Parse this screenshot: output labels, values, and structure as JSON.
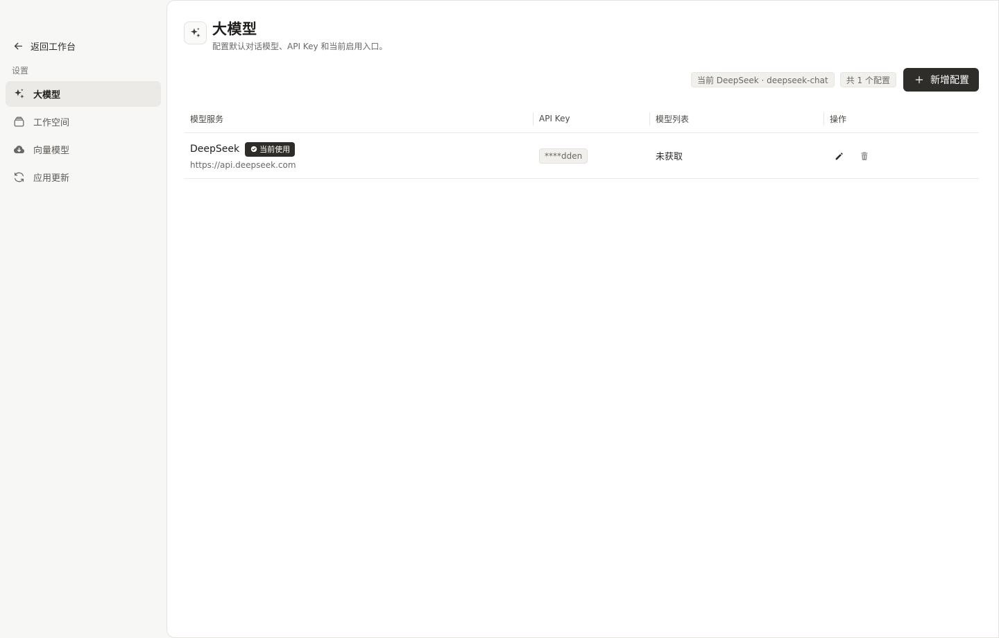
{
  "sidebar": {
    "back_label": "返回工作台",
    "section_label": "设置",
    "items": [
      {
        "label": "大模型",
        "icon": "sparkles-icon",
        "active": true
      },
      {
        "label": "工作空间",
        "icon": "archive-icon",
        "active": false
      },
      {
        "label": "向量模型",
        "icon": "cloud-download-icon",
        "active": false
      },
      {
        "label": "应用更新",
        "icon": "refresh-icon",
        "active": false
      }
    ]
  },
  "header": {
    "title": "大模型",
    "subtitle": "配置默认对话模型、API Key 和当前启用入口。",
    "icon": "sparkles-icon"
  },
  "toolbar": {
    "current_chip": "当前 DeepSeek · deepseek-chat",
    "count_chip": "共 1 个配置",
    "add_label": "新增配置"
  },
  "table": {
    "columns": [
      "模型服务",
      "API Key",
      "模型列表",
      "操作"
    ],
    "rows": [
      {
        "name": "DeepSeek",
        "badge": "当前使用",
        "url": "https://api.deepseek.com",
        "api_key": "****dden",
        "model_list": "未获取"
      }
    ]
  },
  "colors": {
    "accent_dark": "#2e2d2a",
    "sidebar_bg": "#f7f7f5",
    "active_item_bg": "#ebeae6",
    "delete_icon": "#9a9894"
  }
}
